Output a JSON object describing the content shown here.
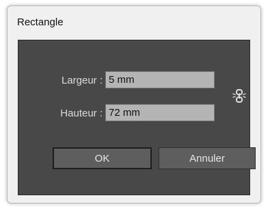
{
  "dialog": {
    "title": "Rectangle",
    "width_label": "Largeur :",
    "width_value": "5 mm",
    "height_label": "Hauteur :",
    "height_value": "72 mm",
    "constrain_icon": "chain-link-icon",
    "ok_label": "OK",
    "cancel_label": "Annuler"
  },
  "colors": {
    "panel_bg": "#484848",
    "field_bg": "#b4b4b4",
    "button_bg": "#5e5e5e",
    "text_light": "#dcdcdc"
  }
}
